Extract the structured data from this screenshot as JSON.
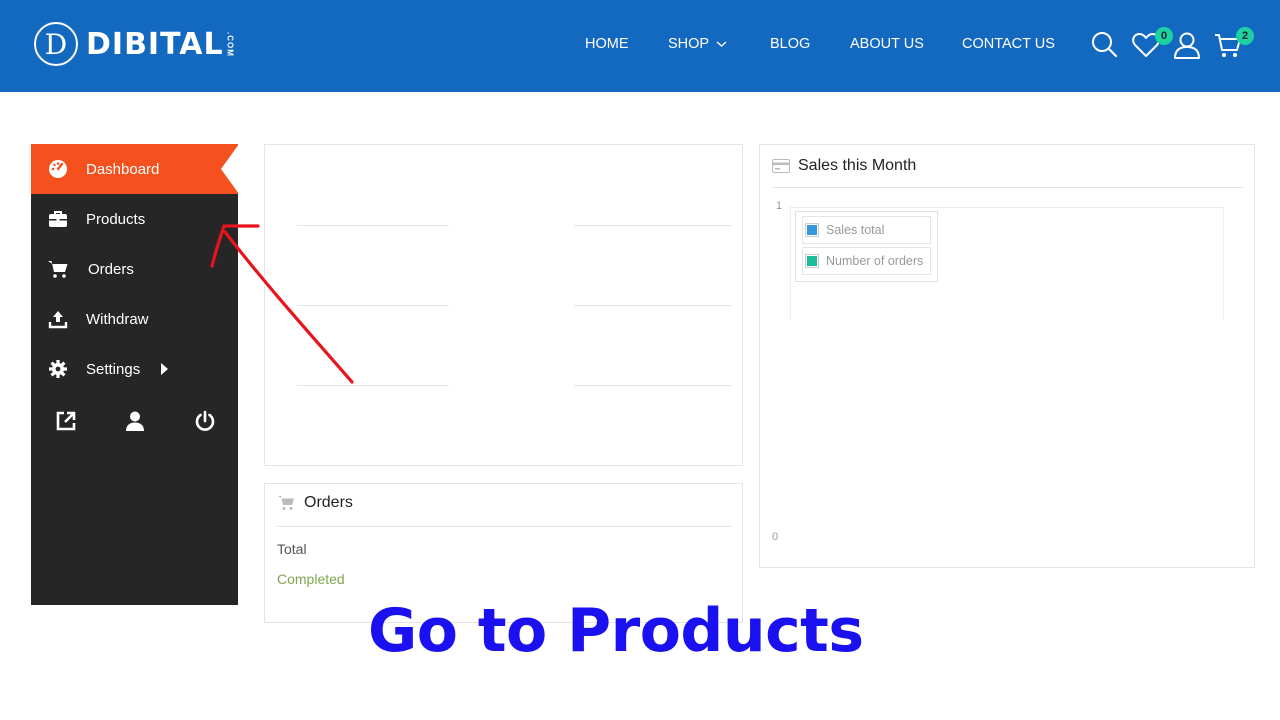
{
  "header": {
    "logo_letter": "D",
    "logo_text": "DIBITAL",
    "logo_suffix": ".COM",
    "nav": [
      {
        "label": "HOME"
      },
      {
        "label": "SHOP"
      },
      {
        "label": "BLOG"
      },
      {
        "label": "ABOUT US"
      },
      {
        "label": "CONTACT US"
      }
    ],
    "wishlist_count": "0",
    "cart_count": "2",
    "icons": [
      "search-icon",
      "heart-icon",
      "user-icon",
      "cart-icon"
    ]
  },
  "sidebar": {
    "items": [
      {
        "label": "Dashboard",
        "icon": "dashboard-icon",
        "active": true
      },
      {
        "label": "Products",
        "icon": "briefcase-icon"
      },
      {
        "label": "Orders",
        "icon": "cart-icon"
      },
      {
        "label": "Withdraw",
        "icon": "upload-icon"
      },
      {
        "label": "Settings",
        "icon": "gear-icon"
      }
    ],
    "bottom_icons": [
      "external-link-icon",
      "user-icon",
      "power-icon"
    ]
  },
  "orders_panel": {
    "title": "Orders",
    "rows": [
      {
        "label": "Total"
      },
      {
        "label": "Completed"
      }
    ]
  },
  "sales_panel": {
    "title": "Sales this Month",
    "y_top": "1",
    "y_bottom": "0",
    "legend": [
      {
        "label": "Sales total",
        "color": "#3498db"
      },
      {
        "label": "Number of orders",
        "color": "#1abc9c"
      }
    ]
  },
  "caption": "Go to Products",
  "colors": {
    "header": "#1368c0",
    "active": "#f4511e",
    "sidebar": "#262626",
    "caption": "#1a10f0",
    "arrow": "#e8141d"
  }
}
